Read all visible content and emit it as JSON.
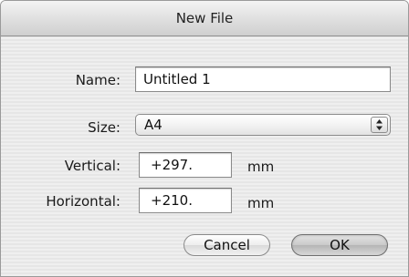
{
  "window": {
    "title": "New File"
  },
  "form": {
    "name_label": "Name:",
    "name_value": "Untitled 1",
    "size_label": "Size:",
    "size_value": "A4",
    "vertical_label": "Vertical:",
    "vertical_value": "+297.",
    "vertical_unit": "mm",
    "horizontal_label": "Horizontal:",
    "horizontal_value": "+210.",
    "horizontal_unit": "mm"
  },
  "buttons": {
    "cancel": "Cancel",
    "ok": "OK"
  },
  "icons": {
    "popup": "up-down-arrows-icon"
  }
}
